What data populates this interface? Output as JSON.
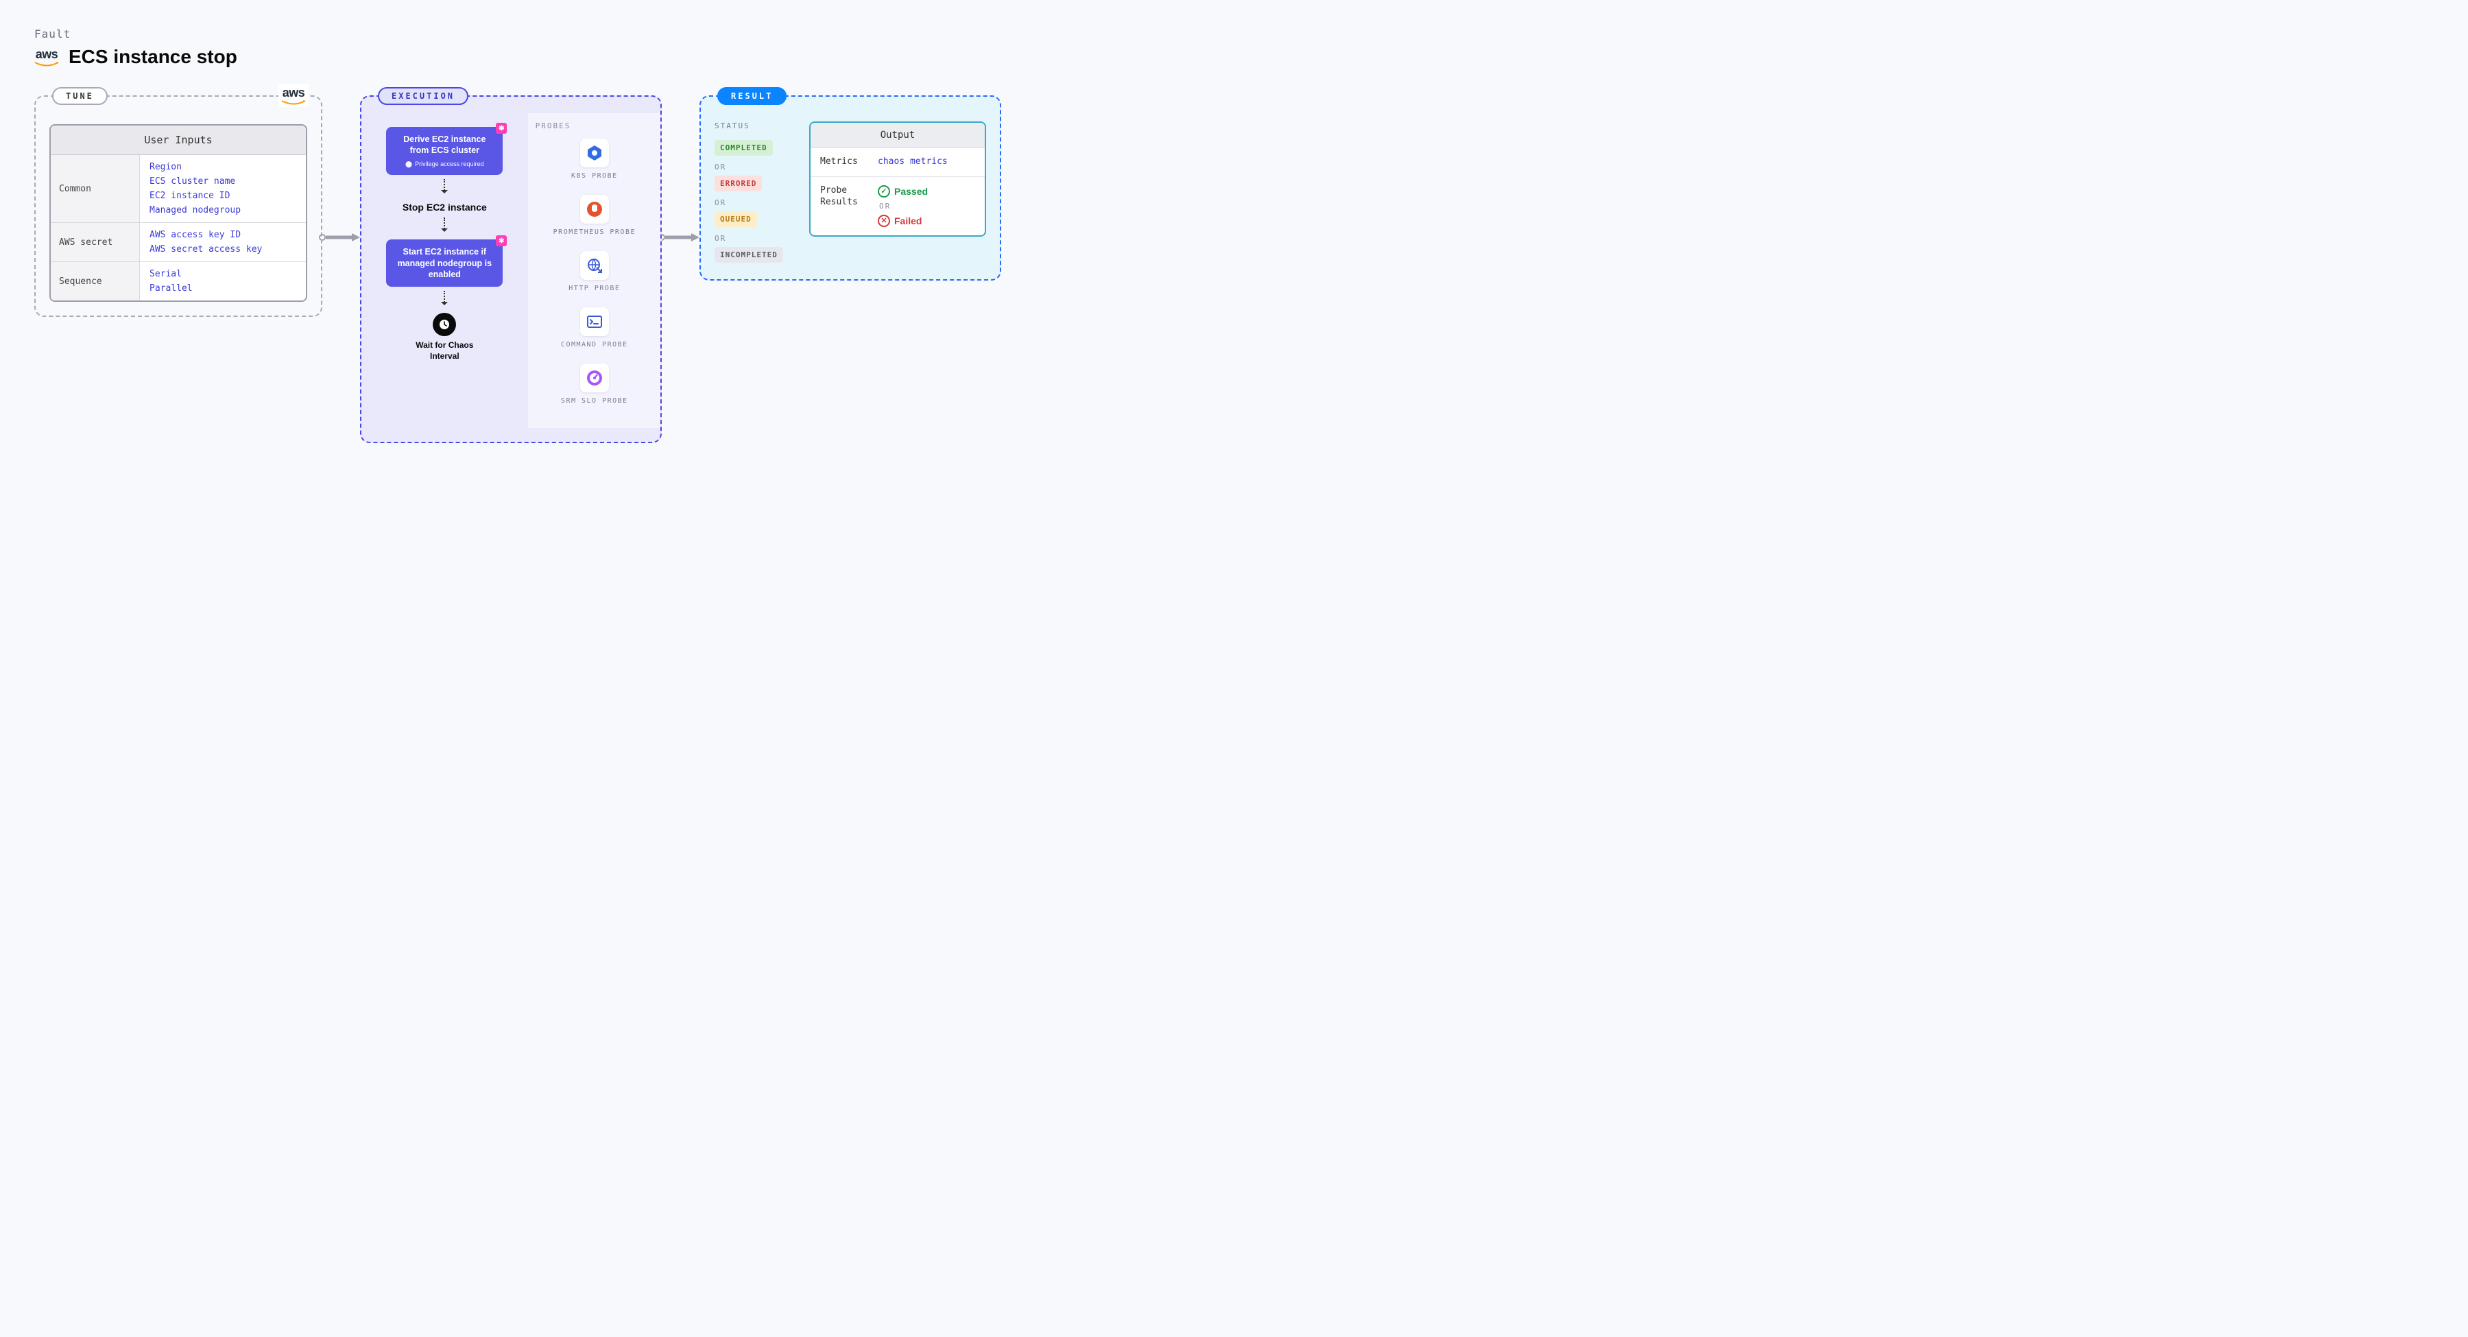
{
  "header": {
    "fault_label": "Fault",
    "provider": "aws",
    "title": "ECS instance stop"
  },
  "tune": {
    "label": "TUNE",
    "provider_badge": "aws",
    "inputs_title": "User Inputs",
    "rows": [
      {
        "key": "Common",
        "values": [
          "Region",
          "ECS cluster name",
          "EC2 instance ID",
          "Managed nodegroup"
        ]
      },
      {
        "key": "AWS secret",
        "values": [
          "AWS access key ID",
          "AWS secret access key"
        ]
      },
      {
        "key": "Sequence",
        "values": [
          "Serial",
          "Parallel"
        ]
      }
    ]
  },
  "execution": {
    "label": "EXECUTION",
    "steps": {
      "derive": "Derive EC2 instance from ECS cluster",
      "derive_note": "Privilege access required",
      "stop": "Stop EC2 instance",
      "start": "Start EC2 instance if managed nodegroup is enabled",
      "wait": "Wait for Chaos Interval"
    },
    "probes_title": "PROBES",
    "probes": [
      {
        "id": "k8s",
        "label": "K8S PROBE"
      },
      {
        "id": "prometheus",
        "label": "PROMETHEUS PROBE"
      },
      {
        "id": "http",
        "label": "HTTP PROBE"
      },
      {
        "id": "command",
        "label": "COMMAND PROBE"
      },
      {
        "id": "srm",
        "label": "SRM SLO PROBE"
      }
    ]
  },
  "result": {
    "label": "RESULT",
    "status_title": "STATUS",
    "or": "OR",
    "statuses": {
      "completed": "COMPLETED",
      "errored": "ERRORED",
      "queued": "QUEUED",
      "incompleted": "INCOMPLETED"
    },
    "output_title": "Output",
    "metrics_key": "Metrics",
    "metrics_val": "chaos metrics",
    "probe_results_key": "Probe Results",
    "passed": "Passed",
    "failed": "Failed"
  }
}
